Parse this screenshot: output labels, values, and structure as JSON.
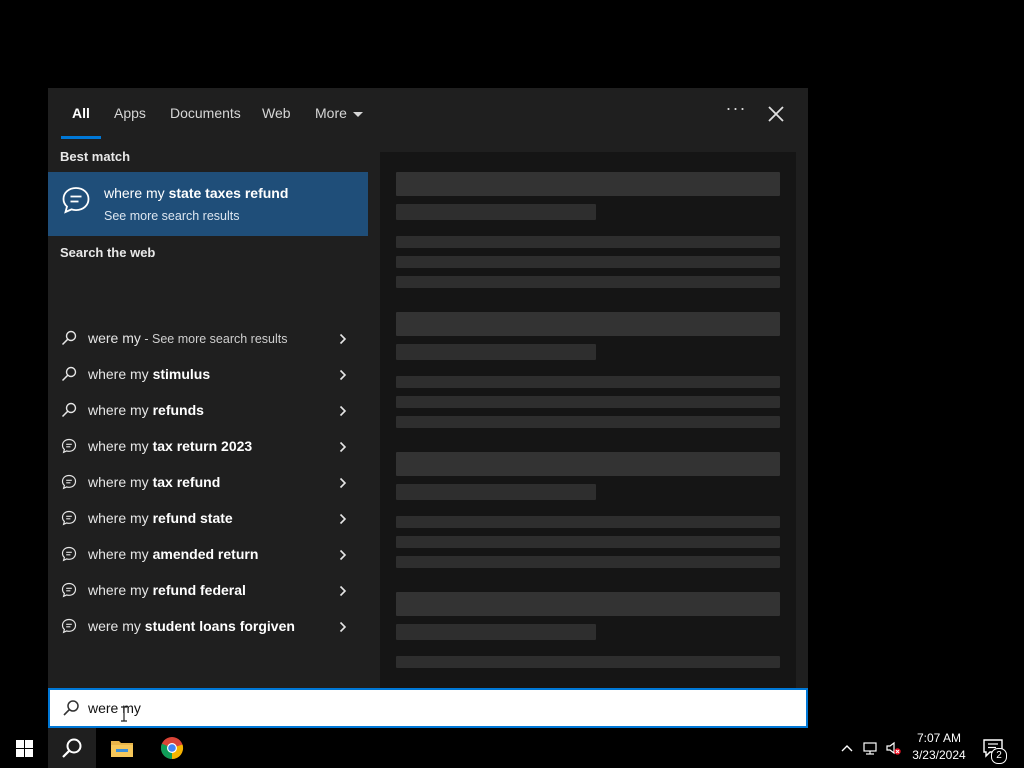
{
  "tabs": [
    {
      "label": "All",
      "active": true
    },
    {
      "label": "Apps"
    },
    {
      "label": "Documents"
    },
    {
      "label": "Web"
    },
    {
      "label": "More"
    }
  ],
  "header_icons": {
    "options": "ellipsis-icon",
    "close": "close-icon",
    "options_glyph": "···"
  },
  "best_match": {
    "section_label": "Best match",
    "title_normal": "where my ",
    "title_bold": "state taxes refund",
    "subtitle": "See more search results",
    "icon": "chat-bubble-icon"
  },
  "web_section": {
    "label": "Search the web",
    "items": [
      {
        "normal": "were my",
        "bold": "",
        "suffix": " - See more search results",
        "icon": "search-icon"
      },
      {
        "normal": "where my ",
        "bold": "stimulus",
        "suffix": "",
        "icon": "search-icon"
      },
      {
        "normal": "where my ",
        "bold": "refunds",
        "suffix": "",
        "icon": "search-icon"
      },
      {
        "normal": "where my ",
        "bold": "tax return 2023",
        "suffix": "",
        "icon": "chat-bubble-icon"
      },
      {
        "normal": "where my ",
        "bold": "tax refund",
        "suffix": "",
        "icon": "chat-bubble-icon"
      },
      {
        "normal": "where my ",
        "bold": "refund state",
        "suffix": "",
        "icon": "chat-bubble-icon"
      },
      {
        "normal": "where my ",
        "bold": "amended return",
        "suffix": "",
        "icon": "chat-bubble-icon"
      },
      {
        "normal": "where my ",
        "bold": "refund federal",
        "suffix": "",
        "icon": "chat-bubble-icon"
      },
      {
        "normal": "were my ",
        "bold": "student loans forgiven",
        "suffix": "",
        "icon": "chat-bubble-icon"
      }
    ]
  },
  "search": {
    "value": "were my",
    "icon": "search-icon"
  },
  "taskbar": {
    "start": "windows-logo-icon",
    "search": "search-icon",
    "explorer": "file-explorer-icon",
    "chrome": "chrome-icon"
  },
  "tray": {
    "time": "7:07 AM",
    "date": "3/23/2024",
    "notification_count": "2"
  },
  "colors": {
    "accent": "#0078d7",
    "highlight": "#1f4e79",
    "panel": "#1f1f1f"
  }
}
